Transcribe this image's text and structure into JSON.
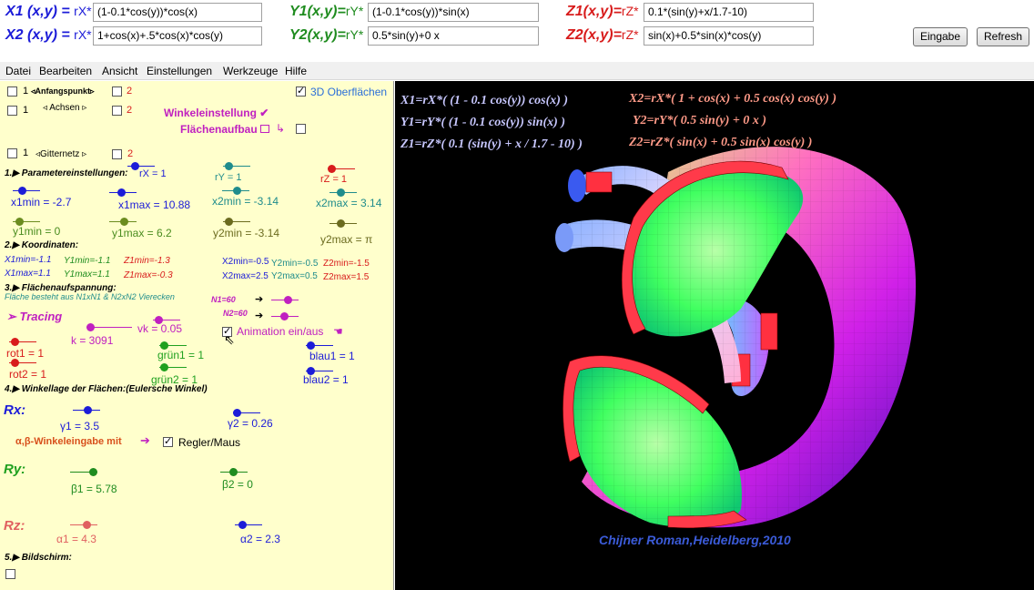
{
  "inputs": {
    "x1_label": "X1 (x,y) =",
    "x1_r": "rX*",
    "x1_value": "(1-0.1*cos(y))*cos(x)",
    "y1_label": "Y1(x,y)=",
    "y1_r": "rY*",
    "y1_value": "(1-0.1*cos(y))*sin(x)",
    "z1_label": "Z1(x,y)=",
    "z1_r": "rZ*",
    "z1_value": "0.1*(sin(y)+x/1.7-10)",
    "x2_label": "X2 (x,y) =",
    "x2_r": "rX*",
    "x2_value": "1+cos(x)+.5*cos(x)*cos(y)",
    "y2_label": "Y2(x,y)=",
    "y2_r": "rY*",
    "y2_value": "0.5*sin(y)+0 x",
    "z2_label": "Z2(x,y)=",
    "z2_r": "rZ*",
    "z2_value": "sin(x)+0.5*sin(x)*cos(y)",
    "enter_label": "Eingabe",
    "refresh_label": "Refresh"
  },
  "menu": [
    "Datei",
    "Bearbeiten",
    "Ansicht",
    "Einstellungen",
    "Werkzeuge",
    "Hilfe"
  ],
  "panel": {
    "anfangspunkt_1": "1",
    "anfangspunkt_label": "◃Anfangspunkt▹",
    "anfangspunkt_2": "2",
    "oberflaechen_label": "3D Oberflächen",
    "achsen_1": "1",
    "achsen_label": "◃ Achsen ▹",
    "achsen_2": "2",
    "winkel_label": "Winkeleinstellung ✔",
    "flaechenaufbau_label": "Flächenaufbau",
    "gitternetz_1": "1",
    "gitternetz_label": "◃Gitternetz ▹",
    "gitternetz_2": "2",
    "sec1": "1.▶ Parametereinstellungen:",
    "rx": "rX = 1",
    "ry": "rY = 1",
    "rz": "rZ = 1",
    "x1min": "x1min = -2.7",
    "x1max": "x1max = 10.88",
    "x2min": "x2min = -3.14",
    "x2max": "x2max = 3.14",
    "y1min": "y1min = 0",
    "y1max": "y1max = 6.2",
    "y2min": "y2min = -3.14",
    "y2max": "y2max = π",
    "sec2": "2.▶ Koordinaten:",
    "c_x1min": "X1min=-1.1",
    "c_y1min": "Y1min=-1.1",
    "c_z1min": "Z1min=-1.3",
    "c_x2min": "X2min=-0.5",
    "c_y2min": "Y2min=-0.5",
    "c_z2min": "Z2min=-1.5",
    "c_x1max": "X1max=1.1",
    "c_y1max": "Y1max=1.1",
    "c_z1max": "Z1max=-0.3",
    "c_x2max": "X2max=2.5",
    "c_y2max": "Y2max=0.5",
    "c_z2max": "Z2max=1.5",
    "sec3": "3.▶ Flächenaufspannung:",
    "sec3_desc": "Fläche  besteht aus N1xN1 & N2xN2 Vierecken",
    "n1": "N1=60",
    "n2": "N2=60",
    "tracing": "➢  Tracing",
    "vk": "vk = 0.05",
    "k": "k = 3091",
    "animation": "Animation ein/aus",
    "rot1": "rot1 = 1",
    "rot2": "rot2 = 1",
    "gruen1": "grün1 = 1",
    "gruen2": "grün2 = 1",
    "blau1": "blau1 = 1",
    "blau2": "blau2 = 1",
    "sec4": "4.▶ Winkellage der Flächen:(Eulersche Winkel)",
    "rx_title": "Rx:",
    "gamma1": "γ1 = 3.5",
    "gamma2": "γ2 = 0.26",
    "ab_label": "α,β-Winkeleingabe mit",
    "regler": "Regler/Maus",
    "ry_title": "Ry:",
    "beta1": "β1 = 5.78",
    "beta2": "β2 = 0",
    "rz_title": "Rz:",
    "alpha1": "α1 = 4.3",
    "alpha2": "α2 = 2.3",
    "sec5": "5.▶ Bildschirm:"
  },
  "render": {
    "eq_x1": "X1=rX*( (1 - 0.1 cos(y)) cos(x) )",
    "eq_y1": "Y1=rY*( (1 - 0.1 cos(y)) sin(x) )",
    "eq_z1": "Z1=rZ*( 0.1 (sin(y) + x / 1.7 - 10) )",
    "eq_x2": "X2=rX*( 1 + cos(x) + 0.5 cos(x) cos(y) )",
    "eq_y2": "Y2=rY*( 0.5 sin(y) + 0 x )",
    "eq_z2": "Z2=rZ*( sin(x) + 0.5 sin(x) cos(y) )",
    "credit": "Chijner Roman,Heidelberg,2010"
  },
  "colors": {
    "x_label": "#1c1cd8",
    "y_label": "#1f8c1f",
    "z_label": "#d81c1c",
    "panel_bg": "#ffffcc",
    "eq1": "#c8c8ff",
    "eq2": "#ff9a88"
  }
}
